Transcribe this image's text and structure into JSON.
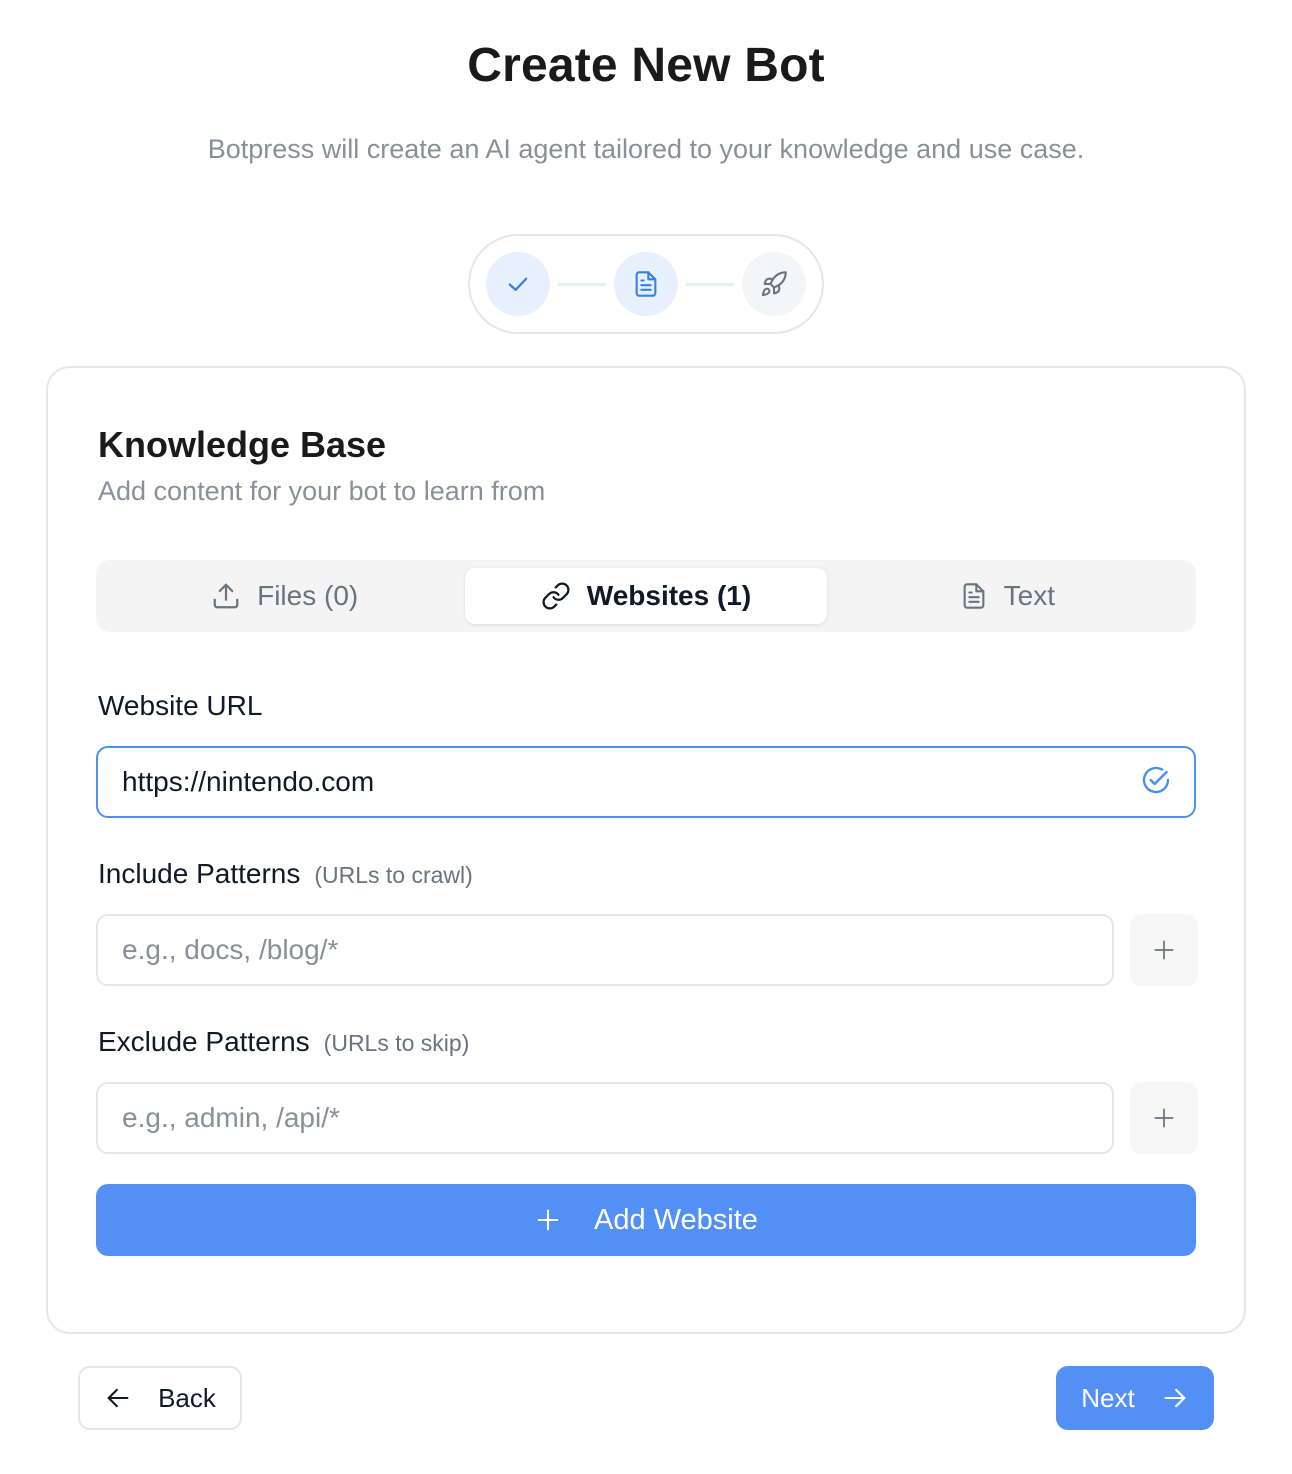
{
  "header": {
    "title": "Create New Bot",
    "subtitle": "Botpress will create an AI agent tailored to your knowledge and use case."
  },
  "stepper": {
    "steps": [
      {
        "icon": "check-icon",
        "state": "done"
      },
      {
        "icon": "document-icon",
        "state": "current"
      },
      {
        "icon": "rocket-icon",
        "state": "pending"
      }
    ]
  },
  "card": {
    "title": "Knowledge Base",
    "subtitle": "Add content for your bot to learn from",
    "tabs": [
      {
        "label": "Files (0)",
        "icon": "upload-icon",
        "active": false
      },
      {
        "label": "Websites (1)",
        "icon": "link-icon",
        "active": true
      },
      {
        "label": "Text",
        "icon": "document-icon",
        "active": false
      }
    ],
    "website_url": {
      "label": "Website URL",
      "value": "https://nintendo.com",
      "status_icon": "check-circle-icon"
    },
    "include": {
      "label": "Include Patterns",
      "hint": "(URLs to crawl)",
      "placeholder": "e.g., docs, /blog/*"
    },
    "exclude": {
      "label": "Exclude Patterns",
      "hint": "(URLs to skip)",
      "placeholder": "e.g., admin, /api/*"
    },
    "add_website_label": "Add Website"
  },
  "footer": {
    "back_label": "Back",
    "next_label": "Next"
  },
  "colors": {
    "accent": "#5290f5",
    "focus_border": "#4a90f0",
    "muted_text": "#8a8f98"
  }
}
